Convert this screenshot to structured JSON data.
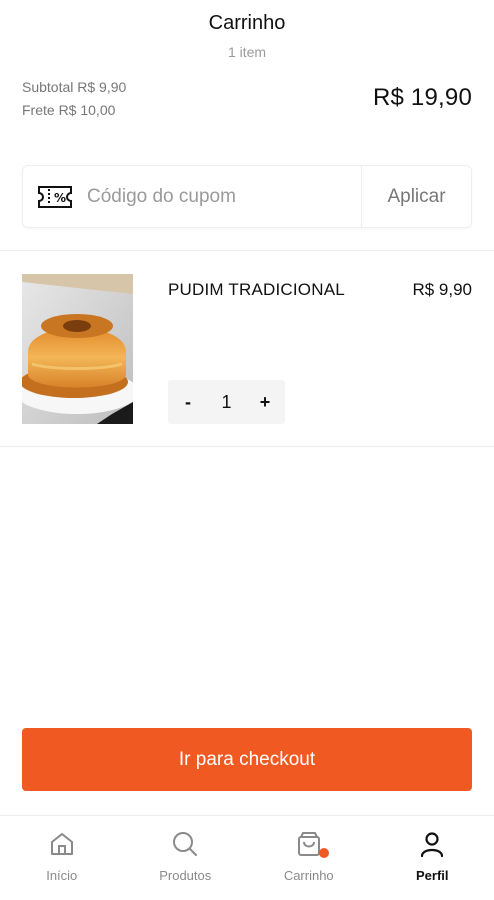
{
  "header": {
    "title": "Carrinho",
    "item_count": "1 item"
  },
  "summary": {
    "subtotal": "Subtotal R$ 9,90",
    "shipping": "Frete R$ 10,00",
    "total": "R$ 19,90"
  },
  "coupon": {
    "placeholder": "Código do cupom",
    "value": "",
    "apply_label": "Aplicar",
    "icon": "coupon-ticket-icon"
  },
  "cart_items": [
    {
      "name": "PUDIM TRADICIONAL",
      "price": "R$ 9,90",
      "quantity": "1",
      "decrement_label": "-",
      "increment_label": "+"
    }
  ],
  "checkout": {
    "label": "Ir para checkout"
  },
  "nav": {
    "tabs": [
      {
        "label": "Início",
        "icon": "home-icon",
        "active": false
      },
      {
        "label": "Produtos",
        "icon": "search-icon",
        "active": false
      },
      {
        "label": "Carrinho",
        "icon": "shopping-bag-icon",
        "active": false,
        "badge": true
      },
      {
        "label": "Perfil",
        "icon": "user-icon",
        "active": true
      }
    ]
  },
  "colors": {
    "accent": "#f05a22",
    "text": "#111111",
    "muted": "#9a9a9a",
    "border": "#eeeeee"
  }
}
